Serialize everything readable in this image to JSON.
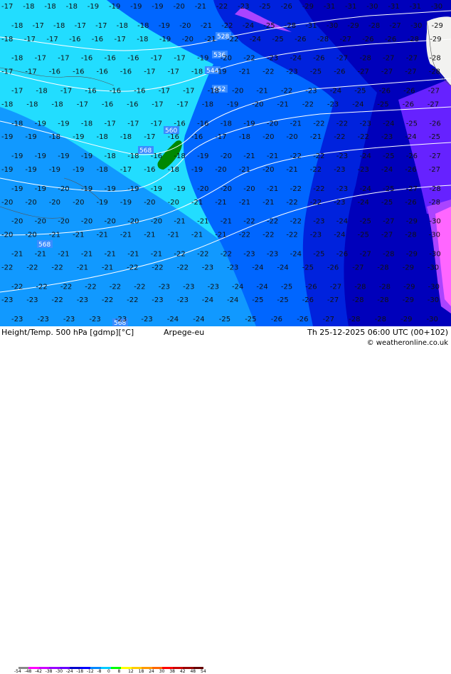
{
  "footer": {
    "title": "Height/Temp. 500 hPa [gdmp][°C]",
    "model": "Arpege-eu",
    "valid": "Th 25-12-2025 06:00 UTC (00+102)",
    "credit": "© weatheronline.co.uk"
  },
  "scale": {
    "labels": [
      "-54",
      "-48",
      "-42",
      "-38",
      "-30",
      "-24",
      "-18",
      "-12",
      "-8",
      "0",
      "8",
      "12",
      "18",
      "24",
      "30",
      "38",
      "42",
      "48",
      "54"
    ],
    "colors": [
      "#888888",
      "#ff00ff",
      "#cc00ff",
      "#9900ff",
      "#6600ff",
      "#0000cc",
      "#0000ff",
      "#0088ff",
      "#00ccff",
      "#00ff00",
      "#ffff00",
      "#ffcc00",
      "#ff9900",
      "#ff6600",
      "#ff0000",
      "#cc0000",
      "#990000",
      "#660000"
    ]
  },
  "map": {
    "colors": {
      "light_cyan": "#22ddff",
      "mid_blue": "#1199ff",
      "blue": "#0066ff",
      "dark_blue": "#0022dd",
      "navy": "#0000bb",
      "purple": "#6622ff",
      "violet": "#aa44ff",
      "pink": "#ff66ff",
      "land": "#f2f2f0",
      "green": "#008800"
    },
    "height_labels": [
      "528",
      "536",
      "544",
      "552",
      "560",
      "568",
      "568",
      "568"
    ],
    "temp_rows": [
      "-17 -18 -18 -18 -19 -19 -19 -19 -20 -21 -22 -23 -25 -26 -29 -31 -31 -30 -31 -31 -30",
      "-18 -17 -18 -17 -17 -18 -18 -19 -20 -21 -22 -24 -25 -28 -31 -30 -29 -28 -27 -30 -29",
      "-18 -17 -17 -16 -16 -17 -18 -19 -20 -21 -22 -24 -25 -26 -28 -27 -26 -26 -28 -29",
      "-18 -17 -17 -16 -16 -16 -17 -17 -19 -20 -22 -23 -24 -26 -27 -28 -27 -27 -28",
      "-17 -17 -16 -16 -16 -16 -17 -17 -18 -19 -21 -22 -23 -25 -26 -27 -27 -27 -28",
      "-17 -18 -17 -16 -16 -16 -17 -17 -18 -20 -21 -22 -23 -24 -25 -26 -26 -27",
      "-18 -18 -18 -17 -16 -16 -17 -17 -18 -19 -20 -21 -22 -23 -24 -25 -26 -27",
      "-18 -19 -19 -18 -17 -17 -17 -16 -16 -18 -19 -20 -21 -22 -22 -23 -24 -25 -26",
      "-19 -19 -18 -19 -18 -18 -17 -16 -16 -17 -18 -20 -20 -21 -22 -22 -23 -24 -25",
      "-19 -19 -19 -19 -18 -18 -16 -18 -19 -20 -21 -21 -22 -22 -23 -24 -25 -26 -27",
      "-19 -19 -19 -19 -18 -17 -16 -18 -19 -20 -21 -20 -21 -22 -23 -23 -24 -26 -27",
      "-19 -19 -20 -19 -19 -19 -19 -19 -20 -20 -20 -21 -22 -22 -23 -24 -25 -27 -28",
      "-20 -20 -20 -20 -19 -19 -20 -20 -21 -21 -21 -21 -22 -22 -23 -24 -25 -26 -28",
      "-20 -20 -20 -20 -20 -20 -20 -21 -21 -21 -22 -22 -22 -23 -24 -25 -27 -29 -30",
      "-20 -20 -21 -21 -21 -21 -21 -21 -21 -21 -22 -22 -22 -23 -24 -25 -27 -28 -30",
      "-21 -21 -21 -21 -21 -21 -21 -22 -22 -22 -23 -23 -24 -25 -26 -27 -28 -29 -30",
      "-22 -22 -22 -21 -21 -22 -22 -22 -23 -23 -24 -24 -25 -26 -27 -28 -29 -30",
      "-22 -22 -22 -22 -22 -22 -23 -23 -23 -24 -24 -25 -26 -27 -28 -28 -29 -30",
      "-23 -23 -22 -23 -22 -22 -23 -23 -24 -24 -25 -25 -26 -27 -28 -28 -29 -30",
      "-23 -23 -23 -23 -23 -23 -24 -24 -25 -25 -26 -26 -27 -28 -28 -29 -30"
    ]
  }
}
